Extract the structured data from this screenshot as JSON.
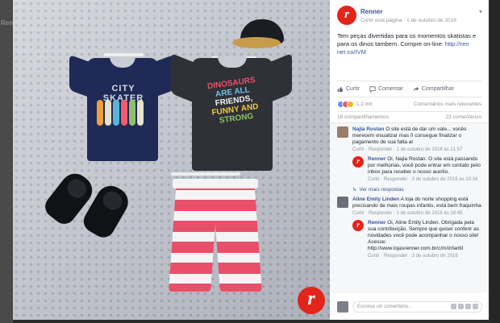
{
  "backdrop": {
    "left_letters": "Ren"
  },
  "post": {
    "page_name": "Renner",
    "meta_prefix": "Curtir esta página",
    "meta_sep": " · ",
    "date": "1 de outubro de 2016",
    "text": "Tem peças divertidas para os momentos skatistas e para os dinos tambem. Compre on-line:",
    "url": "http://ren ner.co/IVM"
  },
  "photo": {
    "shirt1_print": "CITY SKATER",
    "shirt2_print_lines": [
      "DINOSAURS",
      "ARE ALL",
      "FRIENDS,",
      "FUNNY AND",
      "STRONG"
    ],
    "badge": "r"
  },
  "actions": {
    "like": "Curtir",
    "comment": "Comentar",
    "share": "Compartilhar"
  },
  "reactions": {
    "count": "1,2 mil",
    "sort": "Comentários mais relevantes"
  },
  "counts": {
    "shares": "18 compartilhamentos",
    "comments": "23 comentários"
  },
  "comments": [
    {
      "name": "Najla Rostan",
      "text": "O site está de dar um vale... vocês merecem visualizar mas ñ consegue finalizar o pagamento de sua falta al",
      "actions": "Curtir · Responder · 1 de outubro de 2016 às 21:57",
      "replies": [
        {
          "name": "Renner",
          "text": "Oi, Najla Rostan. O site está passando por melhorias, você pode entrar em contato pelo inbox para receber o nosso auxílio.",
          "actions": "Curtir · Responder · 3 de outubro de 2016 às 10:16"
        }
      ],
      "more": "Ver mais respostas"
    },
    {
      "name": "Aline Emily Linden",
      "text": "A loja do norte shopping está precisando de mais roupas infantis, está bem fraquinha",
      "actions": "Curtir · Responder · 1 de outubro de 2016 às 18:45",
      "replies": [
        {
          "name": "Renner",
          "text": "Oi, Aline Emily Linden. Obrigada pela sua contribuição. Sempre que quiser conferir as novidades você pode acompanhar o nosso site! Acesse: http://www.lojasrenner.com.br/c/m/infantil",
          "actions": "Curtir · Responder · 3 de outubro de 2016"
        }
      ],
      "more": ""
    }
  ],
  "write_placeholder": "Escreva um comentário...",
  "colors": {
    "accent": "#365899",
    "brand": "#e2251b"
  }
}
